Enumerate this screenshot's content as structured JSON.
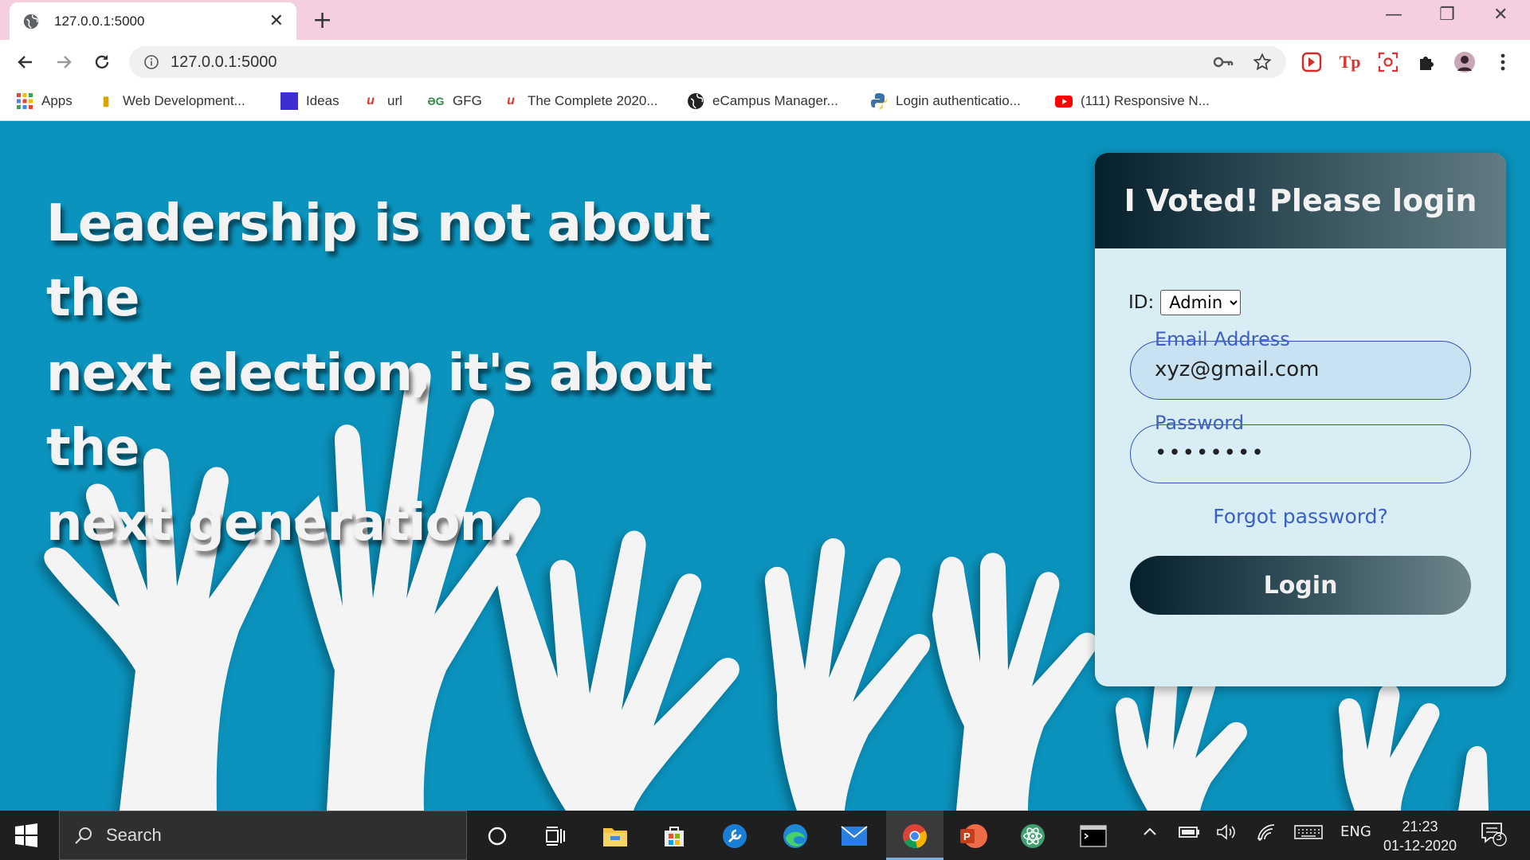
{
  "browser": {
    "tab_title": "127.0.0.1:5000",
    "url": "127.0.0.1:5000",
    "bookmarks": [
      {
        "label": "Apps",
        "icon": "apps-grid-icon"
      },
      {
        "label": "Web Development...",
        "icon": "web-dev-icon"
      },
      {
        "label": "Ideas",
        "icon": "ideas-icon"
      },
      {
        "label": "url",
        "icon": "udemy-icon"
      },
      {
        "label": "GFG",
        "icon": "gfg-icon"
      },
      {
        "label": "The Complete 2020...",
        "icon": "udemy-icon"
      },
      {
        "label": "eCampus Manager...",
        "icon": "globe-icon"
      },
      {
        "label": "Login authenticatio...",
        "icon": "python-icon"
      },
      {
        "label": "(111) Responsive N...",
        "icon": "youtube-icon"
      }
    ]
  },
  "page": {
    "quote_lines": [
      "Leadership is not about the",
      "next election, it's about the",
      "next generation."
    ],
    "card": {
      "title": "I Voted! Please login",
      "id_label": "ID:",
      "id_selected": "Admin",
      "email_label": "Email Address",
      "email_value": "xyz@gmail.com",
      "password_label": "Password",
      "password_value": "••••••••",
      "forgot_label": "Forgot password?",
      "login_label": "Login"
    }
  },
  "taskbar": {
    "search_label": "Search",
    "language": "ENG",
    "time": "21:23",
    "date": "01-12-2020",
    "notification_count": "3"
  },
  "colors": {
    "page_background": "#0a93bd",
    "card_background": "#d8eef4",
    "accent_blue": "#3f5fc4",
    "tab_strip": "#f5cfe0"
  }
}
